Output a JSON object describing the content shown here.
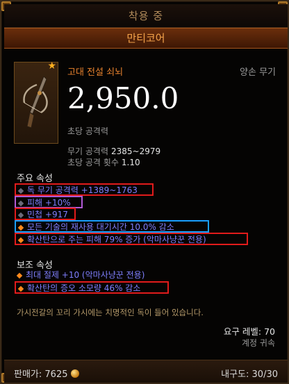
{
  "header": {
    "title": "착용 중"
  },
  "item": {
    "name": "만티코어",
    "type": "고대 전설 쇠뇌",
    "slot": "양손 무기",
    "dps": "2,950.0",
    "dps_label": "초당 공격력",
    "damage_label": "무기 공격력",
    "damage_value": "2385~2979",
    "speed_label": "초당 공격 횟수",
    "speed_value": "1.10",
    "icon": "crossbow-icon",
    "ancient_star_icon": "star-icon"
  },
  "primary": {
    "title": "주요 속성",
    "affixes": [
      {
        "text": "독 무기 공격력 +1389~1763",
        "bullet": "grey",
        "highlight": "red"
      },
      {
        "text": "피해 +10%",
        "bullet": "grey",
        "highlight": "purple"
      },
      {
        "text": "민첩 +917",
        "bullet": "grey",
        "highlight": "red"
      },
      {
        "text": "모든 기술의 재사용 대기시간 10.0% 감소",
        "bullet": "orange",
        "highlight": "blue"
      },
      {
        "text": "확산탄으로 주는 피해 79% 증가 (악마사냥꾼 전용)",
        "bullet": "orange",
        "highlight": "red"
      }
    ]
  },
  "secondary": {
    "title": "보조 속성",
    "affixes": [
      {
        "text": "최대 절제 +10 (악마사냥꾼 전용)",
        "bullet": "orange",
        "highlight": "none"
      },
      {
        "text": "확산탄의 증오 소모량 46% 감소",
        "bullet": "orange",
        "highlight": "red"
      }
    ]
  },
  "flavor": "가시전갈의 꼬리 가시에는 치명적인 독이 들어 있습니다.",
  "requirement": "요구 레벨: 70",
  "binding": "계정 귀속",
  "footer": {
    "sell_label": "판매가:",
    "sell_value": "7625",
    "durability_label": "내구도:",
    "durability_value": "30/30"
  },
  "colors": {
    "legendary": "#e8822e",
    "magic": "#7f7fff",
    "highlight_red": "#e11b1b",
    "highlight_purple": "#b25ad6",
    "highlight_blue": "#1aa0ff"
  }
}
